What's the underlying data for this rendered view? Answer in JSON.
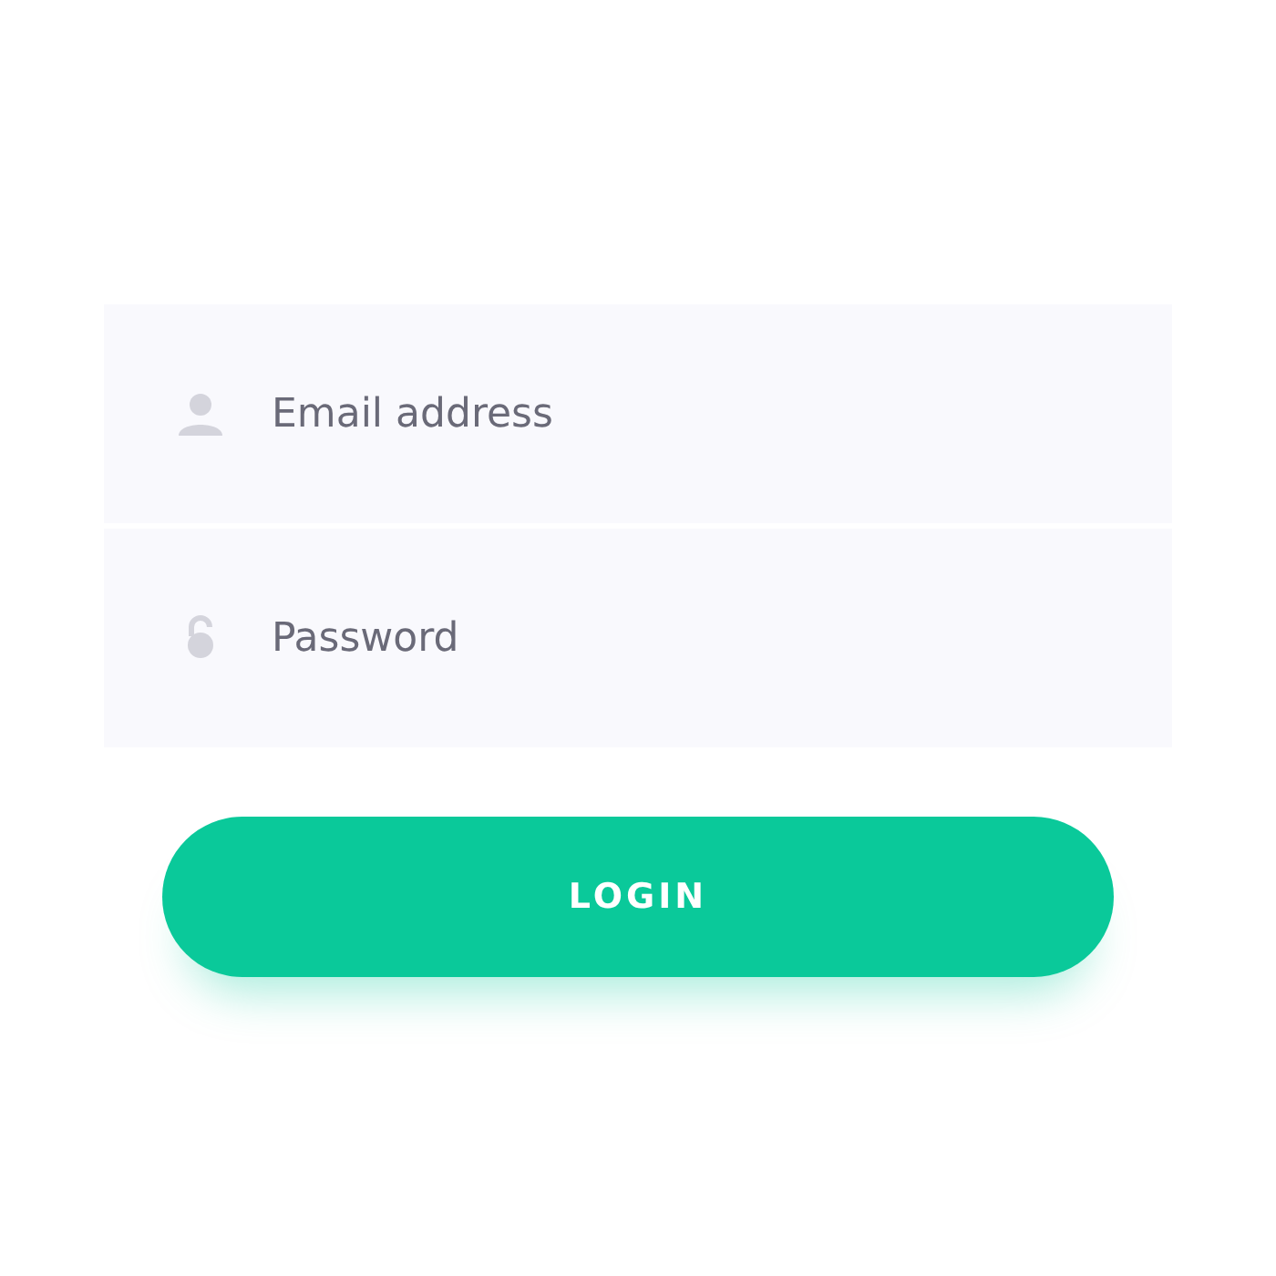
{
  "fields": [
    {
      "kind": "user",
      "placeholder": "Email address"
    },
    {
      "kind": "lock",
      "placeholder": "Password"
    }
  ],
  "button": {
    "label": "LOGIN"
  }
}
